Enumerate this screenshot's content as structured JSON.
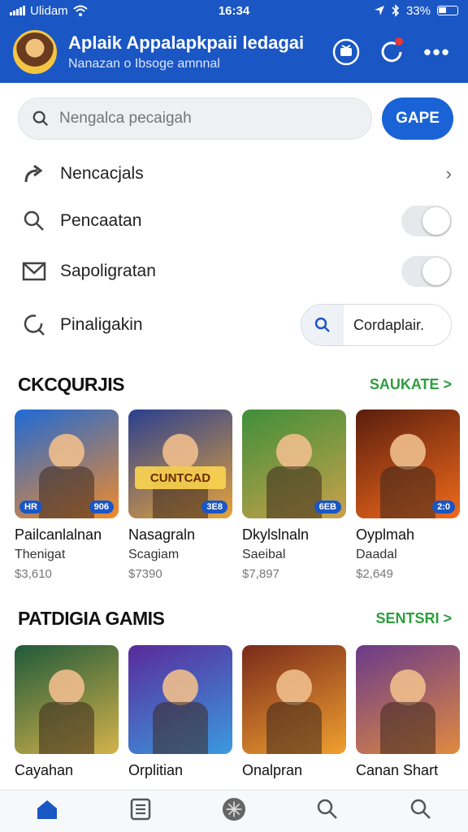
{
  "status_bar": {
    "carrier": "Ulidam",
    "time": "16:34",
    "battery": "33%"
  },
  "header": {
    "title": "Aplaik Appalapkpaii ledagai",
    "subtitle": "Nanazan o Ibsoge amnnal"
  },
  "search": {
    "placeholder": "Nengalca pecaigah",
    "button_label": "GAPE"
  },
  "settings": [
    {
      "label": "Nencacjals",
      "icon": "share-arrow-icon",
      "control": "chevron"
    },
    {
      "label": "Pencaatan",
      "icon": "search-icon",
      "control": "toggle"
    },
    {
      "label": "Sapoligratan",
      "icon": "mail-icon",
      "control": "toggle"
    },
    {
      "label": "Pinaligakin",
      "icon": "refresh-search-icon",
      "control": "search-field",
      "field_value": "Cordaplair."
    }
  ],
  "sections": [
    {
      "title": "CKCQURJIS",
      "link": "SAUKATE >",
      "items": [
        {
          "name": "Pailcanlalnan",
          "sub": "Thenigat",
          "price": "$3,610",
          "tag_left": "HR",
          "tag_right": "906",
          "banner": "",
          "colors": [
            "#1f6ad6",
            "#f08a2a"
          ]
        },
        {
          "name": "Nasagraln",
          "sub": "Scagiam",
          "price": "$7390",
          "tag_left": "",
          "tag_right": "3E8",
          "banner": "CUNTCAD",
          "colors": [
            "#2a3f8f",
            "#e6a33a"
          ]
        },
        {
          "name": "Dkylslnaln",
          "sub": "Saeibal",
          "price": "$7,897",
          "tag_left": "",
          "tag_right": "6EB",
          "banner": "",
          "colors": [
            "#3f8f3a",
            "#c9a14a"
          ]
        },
        {
          "name": "Oyplmah",
          "sub": "Daadal",
          "price": "$2,649",
          "tag_left": "",
          "tag_right": "2:0",
          "banner": "",
          "colors": [
            "#5a1e0e",
            "#f26a1b"
          ]
        }
      ]
    },
    {
      "title": "PATDIGIA GAMIS",
      "link": "SENTSRI >",
      "items": [
        {
          "name": "Cayahan",
          "sub": "",
          "price": "",
          "tag_left": "",
          "tag_right": "",
          "banner": "",
          "colors": [
            "#1f5a3a",
            "#d4b24a"
          ]
        },
        {
          "name": "Orplitian",
          "sub": "",
          "price": "",
          "tag_left": "",
          "tag_right": "",
          "banner": "",
          "colors": [
            "#5a2a9a",
            "#3a9ae0"
          ]
        },
        {
          "name": "Onalpran",
          "sub": "",
          "price": "",
          "tag_left": "",
          "tag_right": "",
          "banner": "",
          "colors": [
            "#7a2a1a",
            "#f0a030"
          ]
        },
        {
          "name": "Canan Shart",
          "sub": "",
          "price": "",
          "tag_left": "",
          "tag_right": "",
          "banner": "",
          "colors": [
            "#6a3a8a",
            "#e08a40"
          ]
        }
      ]
    }
  ],
  "accent_color": "#1a56c4",
  "link_color": "#2e9e3e"
}
